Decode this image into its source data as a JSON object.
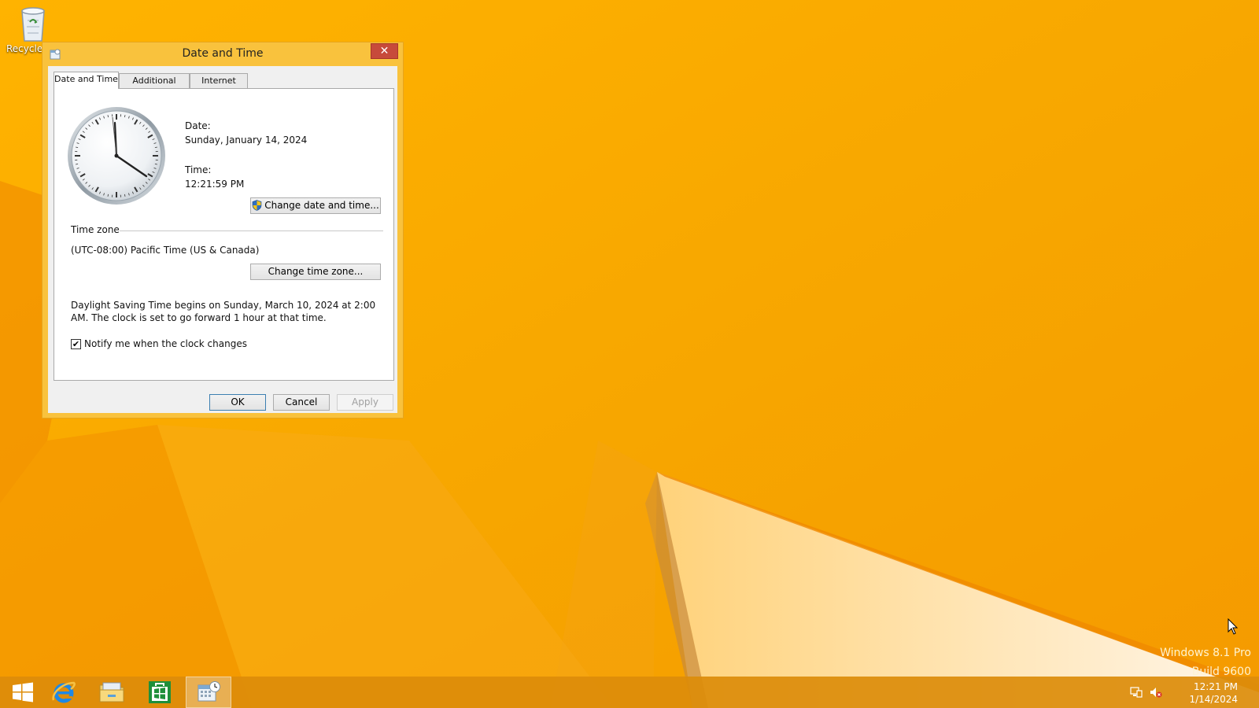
{
  "desktop": {
    "recycle_bin_label": "Recycle",
    "watermark": {
      "line1": "Windows 8.1 Pro",
      "line2": "Build 9600"
    }
  },
  "dialog": {
    "title": "Date and Time",
    "close_glyph": "✕",
    "tabs": [
      {
        "label": "Date and Time",
        "active": true
      },
      {
        "label": "Additional Clocks",
        "active": false
      },
      {
        "label": "Internet Time",
        "active": false
      }
    ],
    "date_label": "Date:",
    "date_value": "Sunday, January 14, 2024",
    "time_label": "Time:",
    "time_value": "12:21:59 PM",
    "change_date_button": "Change date and time...",
    "timezone_heading": "Time zone",
    "timezone_value": "(UTC-08:00) Pacific Time (US & Canada)",
    "change_timezone_button": "Change time zone...",
    "dst_info": "Daylight Saving Time begins on Sunday, March 10, 2024 at 2:00 AM. The clock is set to go forward 1 hour at that time.",
    "notify_checkbox": {
      "label": "Notify me when the clock changes",
      "checked": true,
      "glyph": "✔"
    },
    "buttons": {
      "ok": "OK",
      "cancel": "Cancel",
      "apply": "Apply"
    }
  },
  "taskbar": {
    "items": [
      "start-icon",
      "internet-explorer-icon",
      "file-explorer-icon",
      "store-icon",
      "date-time-app-icon"
    ],
    "active_item": "date-time-app-icon",
    "tray": {
      "icons": [
        "network-icon",
        "volume-muted-icon"
      ],
      "time": "12:21 PM",
      "date": "1/14/2024"
    }
  },
  "colors": {
    "desktop_accent": "#f7a400",
    "window_frame": "#f9c23d",
    "close_button": "#c74a3b",
    "taskbar": "#dc8c0a"
  }
}
